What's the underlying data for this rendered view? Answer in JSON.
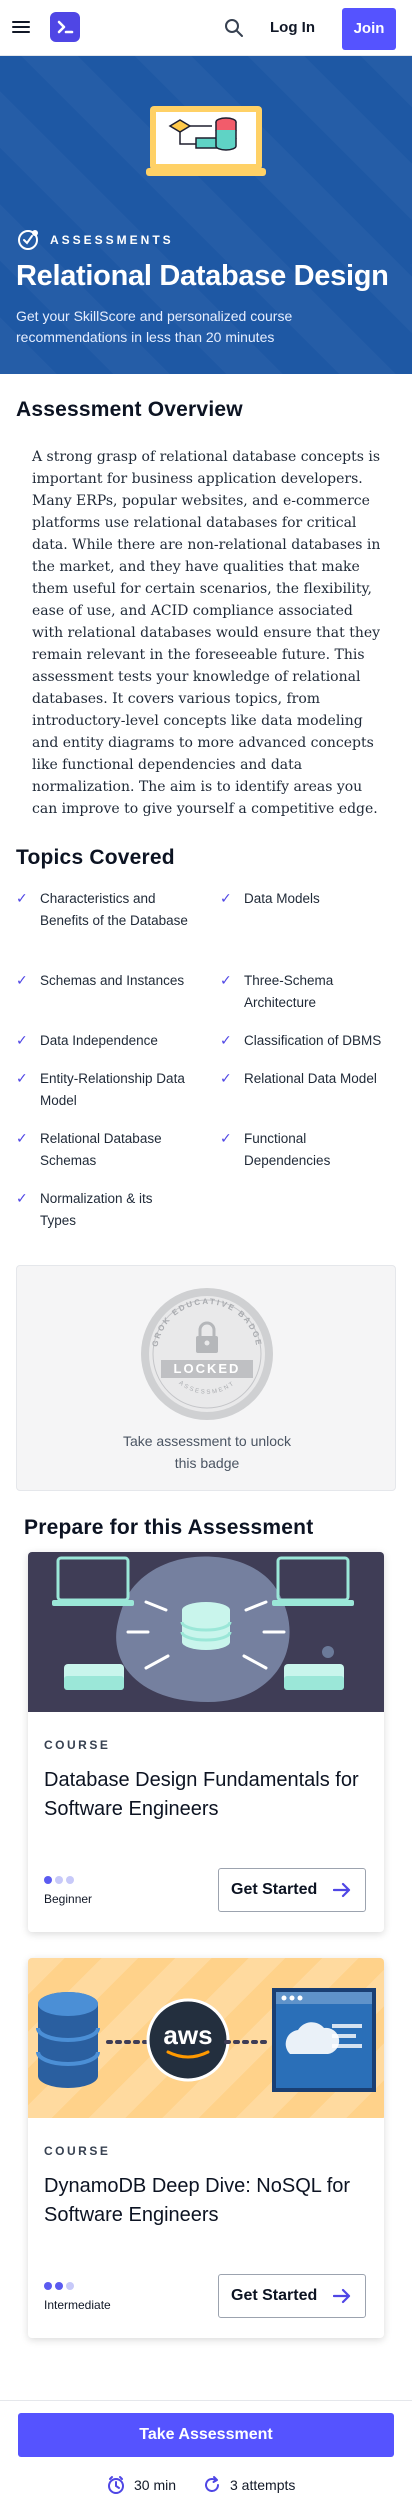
{
  "nav": {
    "login_label": "Log In",
    "join_label": "Join"
  },
  "hero": {
    "tag": "ASSESSMENTS",
    "title": "Relational Database Design",
    "subtitle": "Get your SkillScore and personalized course recommendations in less than 20 minutes"
  },
  "overview": {
    "title": "Assessment Overview",
    "text": "A strong grasp of relational database concepts is important for business application developers. Many ERPs, popular websites, and e-commerce platforms use relational databases for critical data. While there are non-relational databases in the market, and they have qualities that make them useful for certain scenarios, the flexibility, ease of use, and ACID compliance associated with relational databases would ensure that they remain relevant in the foreseeable future. This assessment tests your knowledge of relational databases. It covers various topics, from introductory-level concepts like data modeling and entity diagrams to more advanced concepts like functional dependencies and data normalization. The aim is to identify areas you can improve to give yourself a competitive edge."
  },
  "topics": {
    "title": "Topics Covered",
    "items": [
      "Characteristics and Benefits of the Database",
      "Data Models",
      "Schemas and Instances",
      "Three-Schema Architecture",
      "Data Independence",
      "Classification of DBMS",
      "Entity-Relationship Data Model",
      "Relational Data Model",
      "Relational Database Schemas",
      "Functional Dependencies",
      "Normalization & its Types"
    ]
  },
  "badge": {
    "ring_text": "GROK EDUCATIVE BADGE",
    "status": "LOCKED",
    "bottom_text": "ASSESSMENT",
    "caption": "Take assessment to unlock this badge"
  },
  "prepare": {
    "title": "Prepare for this Assessment",
    "courses": [
      {
        "kind": "COURSE",
        "title": "Database Design Fundamentals for Software Engineers",
        "level": "Beginner",
        "level_value": 1,
        "level_max": 3,
        "cta": "Get Started"
      },
      {
        "kind": "COURSE",
        "title": "DynamoDB Deep Dive: NoSQL for Software Engineers",
        "level": "Intermediate",
        "level_value": 2,
        "level_max": 3,
        "cta": "Get Started",
        "logo_text": "aws"
      }
    ]
  },
  "footer": {
    "cta": "Take Assessment",
    "duration": "30 min",
    "attempts": "3 attempts"
  },
  "colors": {
    "brand": "#5553ff",
    "hero_bg": "#1e58a4",
    "check": "#4f46e5"
  },
  "icons": [
    "menu-icon",
    "logo-icon",
    "search-icon",
    "assessment-icon",
    "check-icon",
    "lock-icon",
    "arrow-right-icon",
    "clock-icon",
    "refresh-icon"
  ]
}
